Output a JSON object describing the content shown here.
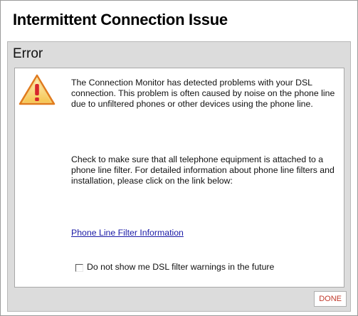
{
  "dialog": {
    "title": "Intermittent Connection Issue",
    "section_header": "Error",
    "message_paragraph_1": "The Connection Monitor has detected problems with your DSL connection. This problem is often caused by noise on the phone line due to unfiltered phones or other devices using the phone line.",
    "message_paragraph_2": "Check to make sure that all telephone equipment is attached to a phone line filter. For detailed information about phone line filters and installation, please click on the link below:",
    "link_text": "Phone Line Filter Information",
    "checkbox_label": "Do not show me DSL filter warnings in the future",
    "checkbox_checked": false,
    "done_label": "DONE",
    "icon": "warning-triangle-icon"
  },
  "colors": {
    "panel_bg": "#dcdcdc",
    "link": "#1a1aa6",
    "done_text": "#c0392b",
    "warning_red": "#d7262c",
    "warning_orange": "#f5a323"
  }
}
